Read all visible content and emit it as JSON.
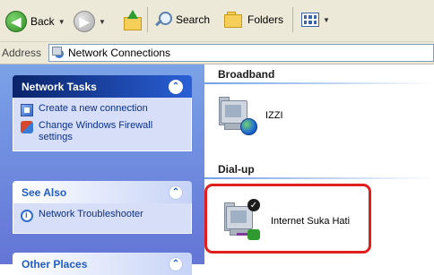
{
  "toolbar": {
    "back_label": "Back",
    "search_label": "Search",
    "folders_label": "Folders"
  },
  "address": {
    "label": "Address",
    "value": "Network Connections"
  },
  "sidebar": {
    "network_tasks": {
      "title": "Network Tasks",
      "items": [
        {
          "label": "Create a new connection",
          "icon": "new-connection-icon"
        },
        {
          "label": "Change Windows Firewall settings",
          "icon": "firewall-icon"
        }
      ]
    },
    "see_also": {
      "title": "See Also",
      "items": [
        {
          "label": "Network Troubleshooter",
          "icon": "troubleshooter-icon"
        }
      ]
    },
    "other_places": {
      "title": "Other Places"
    }
  },
  "content": {
    "broadband": {
      "title": "Broadband",
      "connection_label": "IZZI"
    },
    "dialup": {
      "title": "Dial-up",
      "connection_label": "Internet Suka Hati"
    }
  },
  "colors": {
    "highlight": "#e01e1e",
    "pane_blue": "#6f8fdf"
  }
}
